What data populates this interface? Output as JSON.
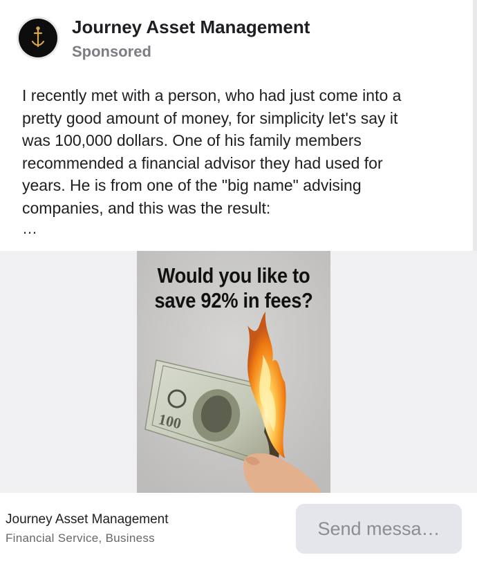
{
  "header": {
    "page_name": "Journey Asset Management",
    "sponsored_label": "Sponsored",
    "avatar_icon": "anchor-logo-icon"
  },
  "post": {
    "lines": [
      "I recently met with a person, who had just come into a",
      "pretty good amount of money, for simplicity let's say it",
      "was 100,000 dollars. One of his family members",
      "recommended a financial advisor they had used for",
      "years. He is from one of the \"big name\" advising",
      "companies, and this was the result:"
    ],
    "more_indicator": "…"
  },
  "ad_image": {
    "headline_line1": "Would you like to",
    "headline_line2": "save 92% in fees?",
    "depiction": "burning-hundred-dollar-bill-icon"
  },
  "footer": {
    "advertiser_name": "Journey Asset Management",
    "category": "Financial Service, Business",
    "cta_label": "Send messa…"
  },
  "colors": {
    "background": "#ffffff",
    "media_background": "#f0eff2",
    "secondary_text": "#65676b",
    "button_background": "#e4e6eb",
    "button_text": "#8a8d91"
  }
}
